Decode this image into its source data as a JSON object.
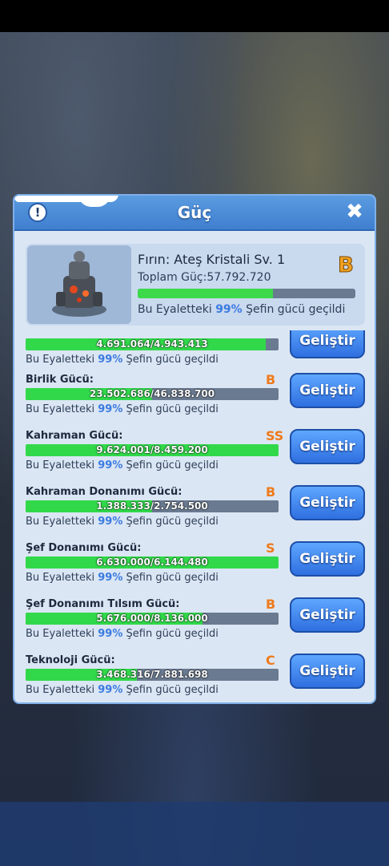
{
  "dialog": {
    "title": "Güç",
    "info_symbol": "!",
    "close_symbol": "✖"
  },
  "header": {
    "name": "Fırın: Ateş Kristali Sv. 1",
    "total": "Toplam Güç:57.792.720",
    "grade": "B",
    "progress": 0.62,
    "note_prefix": "Bu Eyaletteki ",
    "note_pct": "99%",
    "note_suffix": " Şefin gücü geçildi"
  },
  "button_label": "Geliştir",
  "rows": [
    {
      "label": "",
      "grade": "",
      "value": "4.691.064/4.943.413",
      "progress": 0.95,
      "note_prefix": "Bu Eyaletteki ",
      "note_pct": "99%",
      "note_suffix": " Şefin gücü geçildi"
    },
    {
      "label": "Birlik Gücü:",
      "grade": "B",
      "value": "23.502.686/46.838.700",
      "progress": 0.5,
      "note_prefix": "Bu Eyaletteki ",
      "note_pct": "99%",
      "note_suffix": " Şefin gücü geçildi"
    },
    {
      "label": "Kahraman Gücü:",
      "grade": "SS",
      "value": "9.624.001/8.459.200",
      "progress": 1.0,
      "note_prefix": "Bu Eyaletteki ",
      "note_pct": "99%",
      "note_suffix": " Şefin gücü geçildi"
    },
    {
      "label": "Kahraman Donanımı Gücü:",
      "grade": "B",
      "value": "1.388.333/2.754.500",
      "progress": 0.5,
      "note_prefix": "Bu Eyaletteki ",
      "note_pct": "99%",
      "note_suffix": " Şefin gücü geçildi"
    },
    {
      "label": "Şef Donanımı Gücü:",
      "grade": "S",
      "value": "6.630.000/6.144.480",
      "progress": 1.0,
      "note_prefix": "Bu Eyaletteki ",
      "note_pct": "99%",
      "note_suffix": " Şefin gücü geçildi"
    },
    {
      "label": "Şef Donanımı Tılsım Gücü:",
      "grade": "B",
      "value": "5.676.000/8.136.000",
      "progress": 0.7,
      "note_prefix": "Bu Eyaletteki ",
      "note_pct": "99%",
      "note_suffix": " Şefin gücü geçildi"
    },
    {
      "label": "Teknoloji Gücü:",
      "grade": "C",
      "value": "3.468.316/7.881.698",
      "progress": 0.44,
      "note_prefix": "Bu Eyaletteki ",
      "note_pct": "99%",
      "note_suffix": " Şefin gücü geçildi"
    }
  ]
}
